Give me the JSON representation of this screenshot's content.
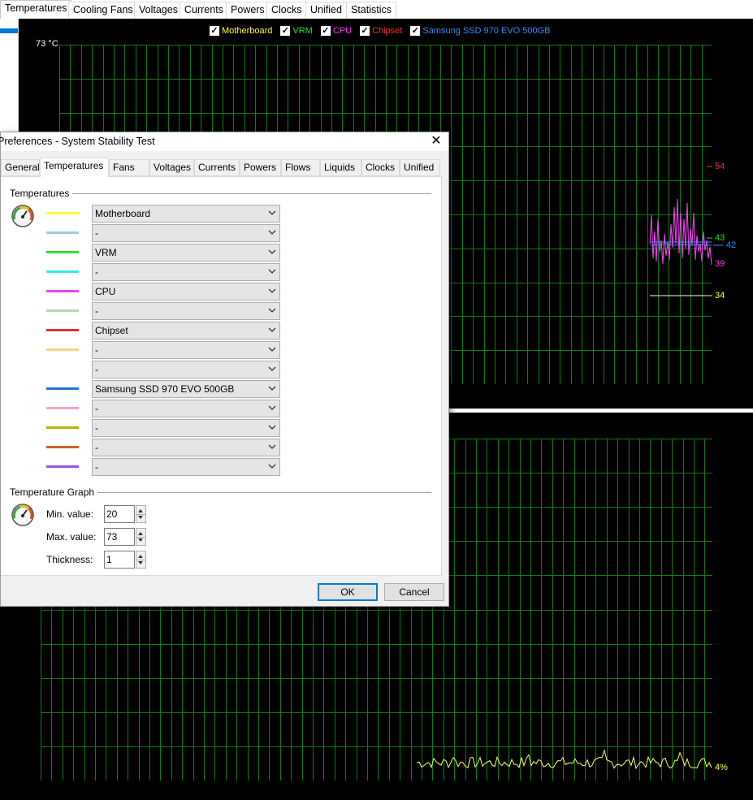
{
  "top_tabs": [
    "Temperatures",
    "Cooling Fans",
    "Voltages",
    "Currents",
    "Powers",
    "Clocks",
    "Unified",
    "Statistics"
  ],
  "top_graph": {
    "max_label": "73 °C",
    "legend": [
      {
        "label": "Motherboard",
        "color": "#ffff20"
      },
      {
        "label": "VRM",
        "color": "#22dd22"
      },
      {
        "label": "CPU",
        "color": "#ff33ff"
      },
      {
        "label": "Chipset",
        "color": "#ff3030"
      },
      {
        "label": "Samsung SSD 970 EVO 500GB",
        "color": "#2d8cff"
      }
    ],
    "readouts": [
      {
        "text": "54",
        "color": "#ff3030"
      },
      {
        "text": "43",
        "color": "#22dd22"
      },
      {
        "text": "42",
        "color": "#2d8cff"
      },
      {
        "text": "39",
        "color": "#ff33ff"
      },
      {
        "text": "34",
        "color": "#ffff20"
      }
    ]
  },
  "bottom_graph": {
    "readout": {
      "text": "4%",
      "color": "#ffff20"
    }
  },
  "dialog": {
    "title": "Preferences - System Stability Test",
    "tabs": [
      "General",
      "Temperatures",
      "Fans",
      "Voltages",
      "Currents",
      "Powers",
      "Flows",
      "Liquids",
      "Clocks",
      "Unified"
    ],
    "active_tab": "Temperatures",
    "temperatures_group": "Temperatures",
    "rows": [
      {
        "color": "#ffff33",
        "value": "Motherboard"
      },
      {
        "color": "#9ecae1",
        "value": "-"
      },
      {
        "color": "#33dd33",
        "value": "VRM"
      },
      {
        "color": "#33e8e8",
        "value": "-"
      },
      {
        "color": "#ee44ee",
        "value": "CPU"
      },
      {
        "color": "#b5d9b5",
        "value": "-"
      },
      {
        "color": "#dd3333",
        "value": "Chipset"
      },
      {
        "color": "#ffd080",
        "value": "-"
      },
      {
        "color": "",
        "value": "-"
      },
      {
        "color": "#1e78d0",
        "value": "Samsung SSD 970 EVO 500GB"
      },
      {
        "color": "#f5a0c8",
        "value": "-"
      },
      {
        "color": "#b5b500",
        "value": "-"
      },
      {
        "color": "#d06030",
        "value": "-"
      },
      {
        "color": "#9955dd",
        "value": "-"
      }
    ],
    "graph_group": "Temperature Graph",
    "min_label": "Min. value:",
    "min_value": "20",
    "max_label": "Max. value:",
    "max_value": "73",
    "thickness_label": "Thickness:",
    "thickness_value": "1",
    "ok": "OK",
    "cancel": "Cancel"
  }
}
